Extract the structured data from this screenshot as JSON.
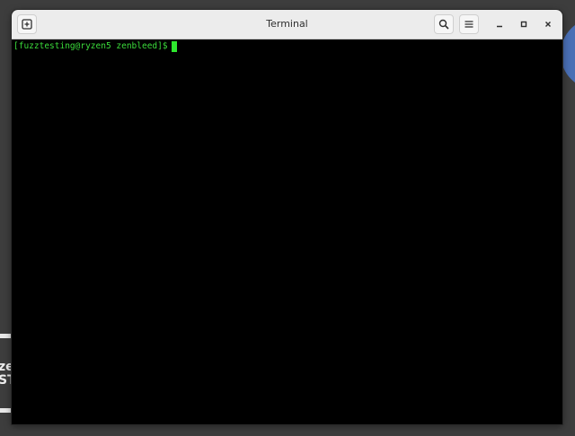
{
  "window": {
    "title": "Terminal"
  },
  "terminal": {
    "prompt": "[fuzztesting@ryzen5 zenbleed]$",
    "input": "",
    "text_color": "#3bdc3b",
    "cursor_color": "#2ee82e"
  },
  "toolbar": {
    "icons": {
      "new_tab": "new-tab-icon",
      "search": "search-icon",
      "menu": "hamburger-menu-icon",
      "minimize": "minimize-icon",
      "maximize": "maximize-icon",
      "close": "close-icon"
    }
  },
  "desktop": {
    "logo_line1": "ze",
    "logo_line2": "ST"
  }
}
